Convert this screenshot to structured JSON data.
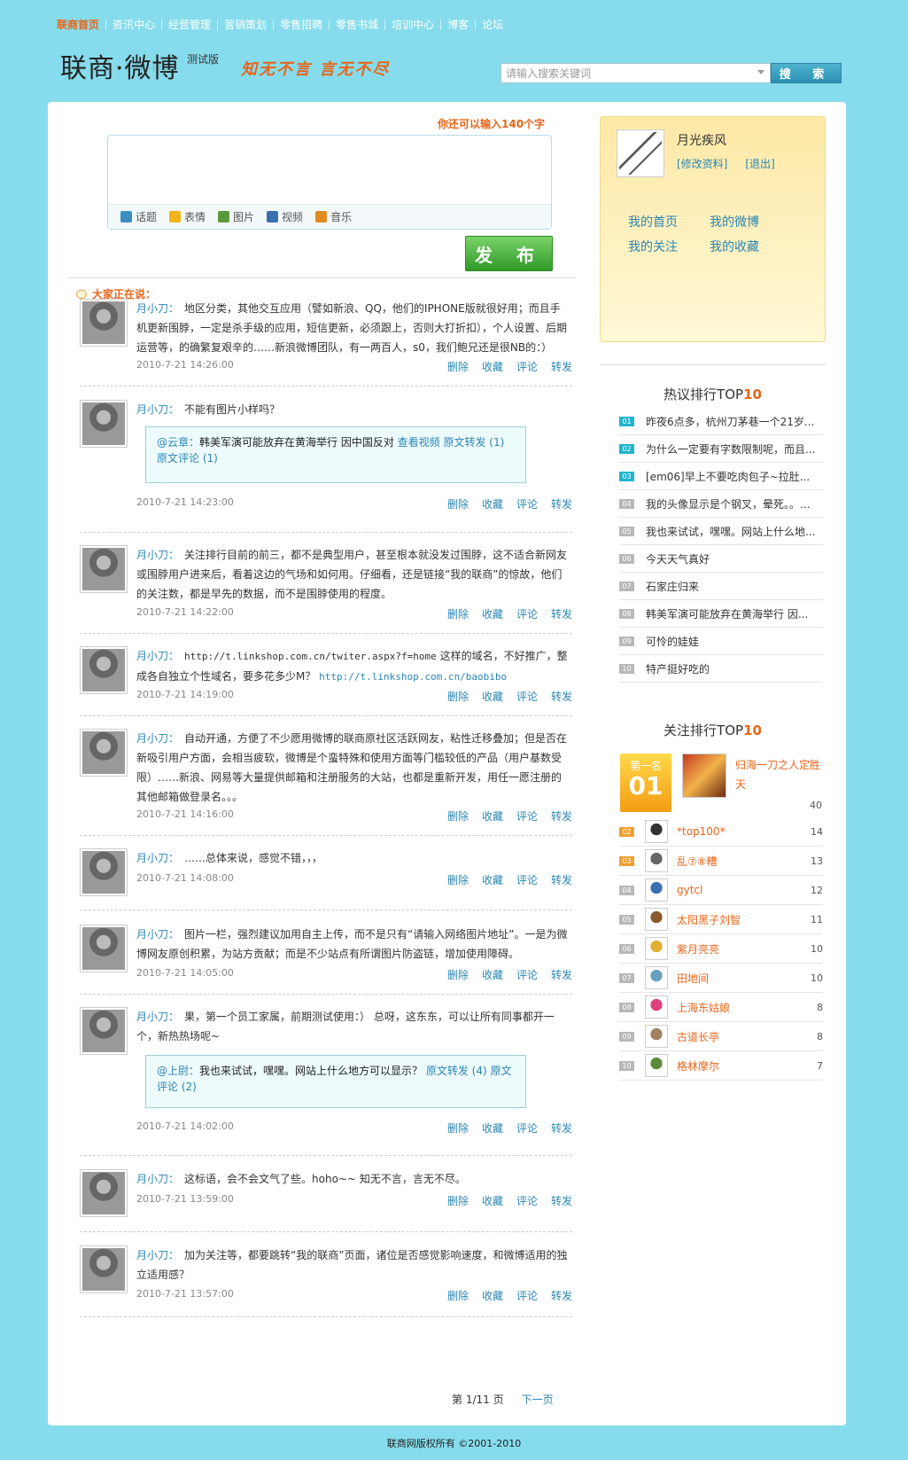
{
  "topnav": [
    "联商首页",
    "资讯中心",
    "经营管理",
    "营销策划",
    "零售招聘",
    "零售书城",
    "培训中心",
    "博客",
    "论坛"
  ],
  "header": {
    "logo": "联商·微博",
    "beta": "测试版",
    "slogan": "知无不言 言无不尽",
    "search_placeholder": "请输入搜索关键词",
    "search_button": "搜 索"
  },
  "composer": {
    "chars_left": "你还可以输入140个字",
    "tools": [
      {
        "icon": "topic-icon",
        "label": "话题",
        "color": "#3a8fc0"
      },
      {
        "icon": "emoji-icon",
        "label": "表情",
        "color": "#f2b41c"
      },
      {
        "icon": "image-icon",
        "label": "图片",
        "color": "#5a9a3a"
      },
      {
        "icon": "video-icon",
        "label": "视频",
        "color": "#3a6fb0"
      },
      {
        "icon": "music-icon",
        "label": "音乐",
        "color": "#e08a20"
      }
    ],
    "publish": "发 布"
  },
  "feed_heading": "大家正在说：",
  "actions": [
    "删除",
    "收藏",
    "评论",
    "转发"
  ],
  "feed": [
    {
      "author": "月小刀：",
      "text": "地区分类，其他交互应用（譬如新浪、QQ，他们的IPHONE版就很好用；而且手机更新围脖，一定是杀手级的应用，短信更新，必须跟上，否则大打折扣），个人设置、后期运营等，的确繁复艰辛的……新浪微博团队，有一两百人，s0，我们鲍兄还是很NB的：）",
      "time": "2010-7-21 14:26:00"
    },
    {
      "author": "月小刀：",
      "text": "不能有图片小样吗？",
      "time": "2010-7-21 14:23:00",
      "quote": {
        "user": "@云章：",
        "text": "韩美军演可能放弃在黄海举行 因中国反对",
        "video": "查看视频",
        "links": [
          "原文转发 (1)",
          "原文评论 (1)"
        ]
      }
    },
    {
      "author": "月小刀：",
      "text": "关注排行目前的前三，都不是典型用户，甚至根本就没发过围脖，这不适合新网友或围脖用户进来后，看着这边的气场和如何用。仔细看，还是链接“我的联商”的惊故，他们的关注数，都是早先的数据，而不是围脖使用的程度。",
      "time": "2010-7-21 14:22:00"
    },
    {
      "author": "月小刀：",
      "text_pre": "http://t.linkshop.com.cn/twiter.aspx?f=home",
      "text": " 这样的域名，不好推广，整成各自独立个性域名，要多花多少M？ ",
      "link": "http://t.linkshop.com.cn/baobibo",
      "time": "2010-7-21 14:19:00"
    },
    {
      "author": "月小刀：",
      "text": "自动开通，方便了不少愿用微博的联商原社区活跃网友，粘性迁移叠加；但是否在新吸引用户方面，会相当疲软，微博是个蛮特殊和使用方面等门槛较低的产品（用户基数受限）……新浪、网易等大量提供邮箱和注册服务的大站，也都是重新开发，用任一愿注册的其他邮箱做登录名。。。",
      "time": "2010-7-21 14:16:00"
    },
    {
      "author": "月小刀：",
      "text": "……总体来说，感觉不错，，，",
      "time": "2010-7-21 14:08:00"
    },
    {
      "author": "月小刀：",
      "text": "图片一栏，强烈建议加用自主上传，而不是只有“请输入网络图片地址”。一是为微博网友原创积累，为站方贡献；而是不少站点有所谓图片防盗链，增加使用障碍。",
      "time": "2010-7-21 14:05:00"
    },
    {
      "author": "月小刀：",
      "text": "果，第一个员工家属，前期测试使用：） 总呀，这东东，可以让所有同事都开一个，新热热场呢~",
      "time": "2010-7-21 14:02:00",
      "quote": {
        "user": "@上尉：",
        "text": "我也来试试，嘿嘿。网站上什么地方可以显示？",
        "links": [
          "原文转发 (4)",
          "原文评论 (2)"
        ]
      }
    },
    {
      "author": "月小刀：",
      "text": "这标语，会不会文气了些。hoho~~ 知无不言，言无不尽。",
      "time": "2010-7-21 13:59:00"
    },
    {
      "author": "月小刀：",
      "text": "加为关注等，都要跳转“我的联商”页面，诸位是否感觉影响速度，和微博适用的独立适用感？",
      "time": "2010-7-21 13:57:00"
    }
  ],
  "pager": {
    "info": "第 1/11 页",
    "next": "下一页"
  },
  "user": {
    "name": "月光疾风",
    "links": [
      "[修改资料]",
      "[退出]"
    ],
    "nav": [
      "我的首页",
      "我的微博",
      "我的关注",
      "我的收藏"
    ]
  },
  "hot": {
    "title": "热议排行TOP",
    "ten": "10",
    "items": [
      "昨夜6点多，杭州刀茅巷一个21岁...",
      "为什么一定要有字数限制呢，而且...",
      "[em06]早上不要吃肉包子~拉肚...",
      "我的头像显示是个钢叉，晕死。。...",
      "我也来试试，嘿嘿。网站上什么地...",
      "今天天气真好",
      "石家庄归来",
      "韩美军演可能放弃在黄海举行 因...",
      "可怜的娃娃",
      "特产挺好吃的"
    ],
    "nums": [
      "01",
      "02",
      "03",
      "04",
      "05",
      "06",
      "07",
      "08",
      "09",
      "10"
    ]
  },
  "follow": {
    "title": "关注排行TOP",
    "ten": "10",
    "first": {
      "label": "第一名",
      "num": "01",
      "name": "归海一刀之人定胜天",
      "count": "40"
    },
    "items": [
      {
        "num": "02",
        "name": "*top100*",
        "count": "14",
        "color": "#333"
      },
      {
        "num": "03",
        "name": "乱⑦⑧糟",
        "count": "13",
        "color": "#666"
      },
      {
        "num": "04",
        "name": "gytcl",
        "count": "12",
        "color": "#3a6fb0"
      },
      {
        "num": "05",
        "name": "太阳黑子刘智",
        "count": "11",
        "color": "#8a5a2a"
      },
      {
        "num": "06",
        "name": "紫月亮亮",
        "count": "10",
        "color": "#e0b030"
      },
      {
        "num": "07",
        "name": "田地间",
        "count": "10",
        "color": "#6aa0c0"
      },
      {
        "num": "08",
        "name": "上海东姑娘",
        "count": "8",
        "color": "#e0407a"
      },
      {
        "num": "09",
        "name": "古道长亭",
        "count": "8",
        "color": "#a08060"
      },
      {
        "num": "10",
        "name": "格林摩尔",
        "count": "7",
        "color": "#5a8a3a"
      }
    ]
  },
  "footer": "联商网版权所有 ©2001-2010"
}
